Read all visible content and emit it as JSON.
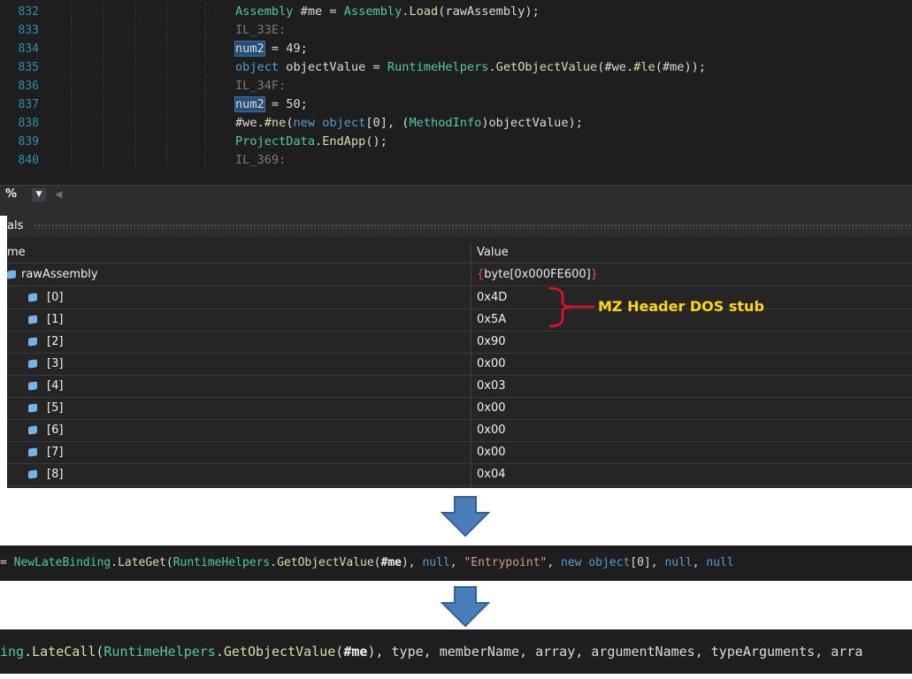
{
  "editor": {
    "lines": [
      {
        "num": "832"
      },
      {
        "num": "833"
      },
      {
        "num": "834"
      },
      {
        "num": "835"
      },
      {
        "num": "836"
      },
      {
        "num": "837"
      },
      {
        "num": "838"
      },
      {
        "num": "839"
      },
      {
        "num": "840"
      }
    ],
    "code": {
      "l832": {
        "t1": "Assembly",
        "t2": " #me = ",
        "t3": "Assembly",
        "t4": ".",
        "t5": "Load",
        "t6": "(rawAssembly);"
      },
      "l833": {
        "t1": "IL_33E:"
      },
      "l834": {
        "t1": "num2",
        "t2": " = 49;"
      },
      "l835": {
        "t1": "object",
        "t2": " objectValue = ",
        "t3": "RuntimeHelpers",
        "t4": ".",
        "t5": "GetObjectValue",
        "t6": "(#we.",
        "t7": "#le",
        "t8": "(#me));"
      },
      "l836": {
        "t1": "IL_34F:"
      },
      "l837": {
        "t1": "num2",
        "t2": " = 50;"
      },
      "l838": {
        "t1": "#we.",
        "t2": "#ne",
        "t3": "(",
        "t4": "new",
        "t5": " ",
        "t6": "object",
        "t7": "[0], (",
        "t8": "MethodInfo",
        "t9": ")objectValue);"
      },
      "l839": {
        "t1": "ProjectData",
        "t2": ".",
        "t3": "EndApp",
        "t4": "();"
      },
      "l840": {
        "t1": "IL_369:"
      }
    }
  },
  "zoombar": {
    "zoom_label": "%",
    "dropdown_glyph": "▼",
    "scroll_glyph": "◀"
  },
  "locals": {
    "title": "als",
    "col_name": "me",
    "col_value": "Value",
    "root": {
      "name": "rawAssembly",
      "value_open": "{",
      "value_inner": "byte[0x000FE600]",
      "value_close": "}"
    },
    "items": [
      {
        "index": "[0]",
        "value": "0x4D"
      },
      {
        "index": "[1]",
        "value": "0x5A"
      },
      {
        "index": "[2]",
        "value": "0x90"
      },
      {
        "index": "[3]",
        "value": "0x00"
      },
      {
        "index": "[4]",
        "value": "0x03"
      },
      {
        "index": "[5]",
        "value": "0x00"
      },
      {
        "index": "[6]",
        "value": "0x00"
      },
      {
        "index": "[7]",
        "value": "0x00"
      },
      {
        "index": "[8]",
        "value": "0x04"
      }
    ]
  },
  "annotation": {
    "text": "MZ Header DOS stub",
    "color": "#ffd800",
    "brace_color": "#e81123"
  },
  "arrow_color": "#4a7ebb",
  "strip1": {
    "a": "= ",
    "b": "NewLateBinding",
    "c": ".",
    "d": "LateGet",
    "e": "(",
    "f": "RuntimeHelpers",
    "g": ".",
    "h": "GetObjectValue",
    "i": "(",
    "j": "#me",
    "k": "), ",
    "l": "null",
    "m": ", ",
    "n": "\"Entrypoint\"",
    "o": ", ",
    "p": "new",
    "q": " ",
    "r": "object",
    "s": "[0], ",
    "t": "null",
    "u": ", ",
    "v": "null"
  },
  "strip2": {
    "a": "ing",
    "b": ".",
    "c": "LateCall",
    "d": "(",
    "e": "RuntimeHelpers",
    "f": ".",
    "g": "GetObjectValue",
    "h": "(",
    "i": "#me",
    "j": "), type, memberName, array, argumentNames, typeArguments, arra"
  }
}
